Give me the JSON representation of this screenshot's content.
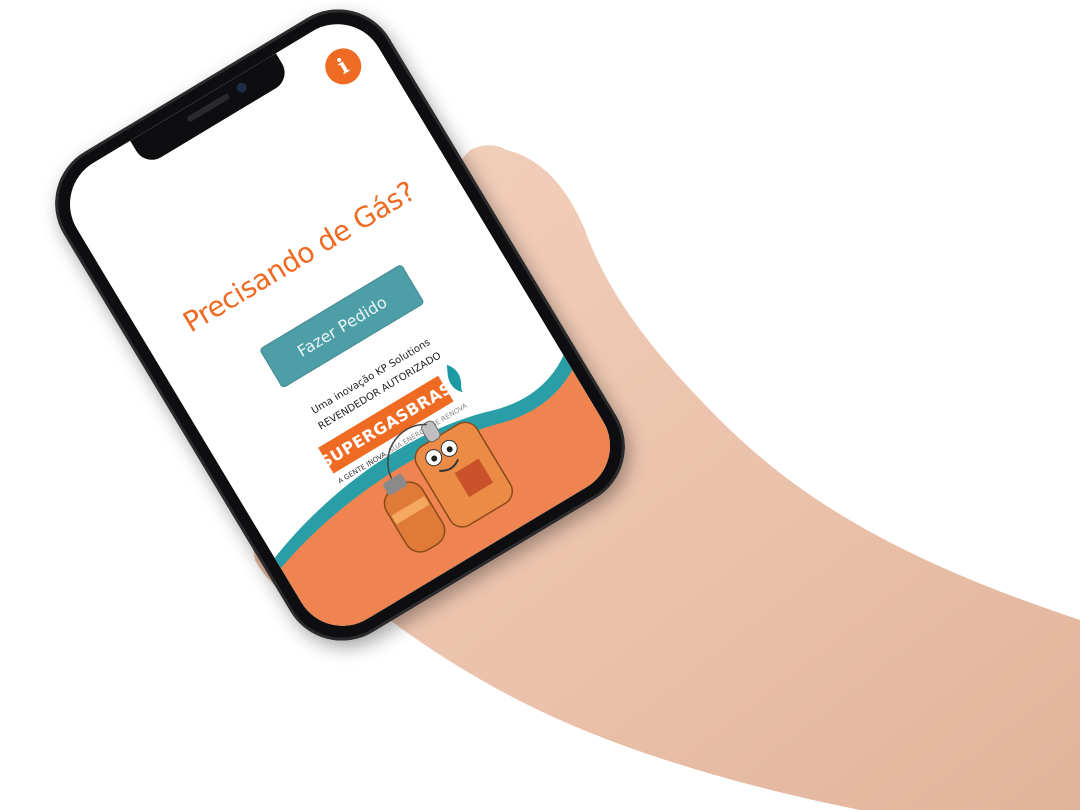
{
  "app": {
    "headline": "Precisando de Gás?",
    "order_button_label": "Fazer Pedido",
    "info_icon": "info-icon",
    "credits": {
      "line1": "Uma inovação KP Solutions",
      "line2": "REVENDEDOR AUTORIZADO"
    },
    "logo": {
      "wordmark": "SUPERGASBRAS",
      "tagline_left": "A GENTE INOVA.",
      "tagline_right": "SUA ENERGIA SE RENOVA"
    }
  },
  "colors": {
    "accent_orange": "#ef6a22",
    "teal": "#4e9ea8",
    "wave_teal": "#2a9ea6",
    "wave_orange": "#f08450"
  }
}
